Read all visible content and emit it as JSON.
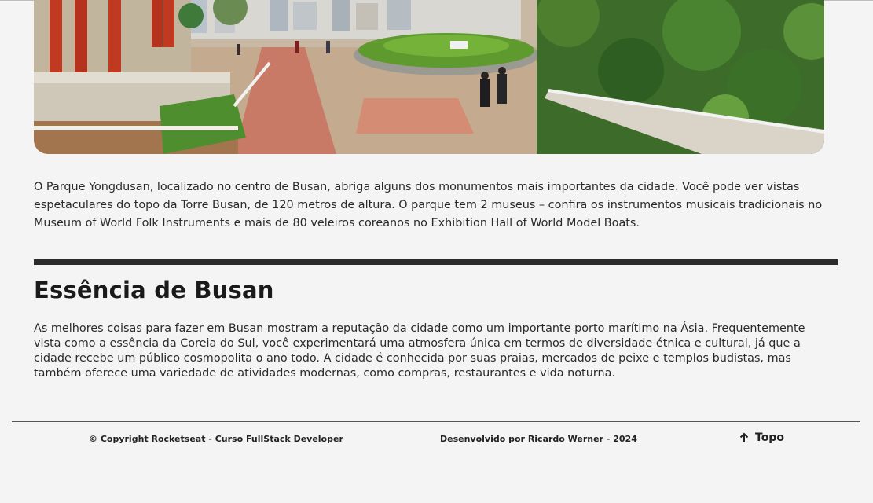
{
  "hero": {
    "image_name": "yongdusan-park-photo"
  },
  "intro": {
    "paragraph": "O Parque Yongdusan, localizado no centro de Busan, abriga alguns dos monumentos mais importantes da cidade. Você pode ver vistas espetaculares do topo da Torre Busan, de 120 metros de altura. O parque tem 2 museus – confira os instrumentos musicais tradicionais no Museum of World Folk Instruments e mais de 80 veleiros coreanos no Exhibition Hall of World Model Boats."
  },
  "section": {
    "title": "Essência de Busan",
    "paragraph": "As melhores coisas para fazer em Busan mostram a reputação da cidade como um importante porto marítimo na Ásia. Frequentemente vista como a essência da Coreia do Sul, você experimentará uma atmosfera única em termos de diversidade étnica e cultural, já que a cidade recebe um público cosmopolita o ano todo. A cidade é conhecida por suas praias, mercados de peixe e templos budistas, mas também oferece uma variedade de atividades modernas, como compras, restaurantes e vida noturna."
  },
  "footer": {
    "copyright": "© Copyright Rocketseat - Curso FullStack Developer",
    "developer": "Desenvolvido por Ricardo Werner - 2024",
    "top_label": "Topo",
    "top_icon": "arrow-up-icon"
  }
}
